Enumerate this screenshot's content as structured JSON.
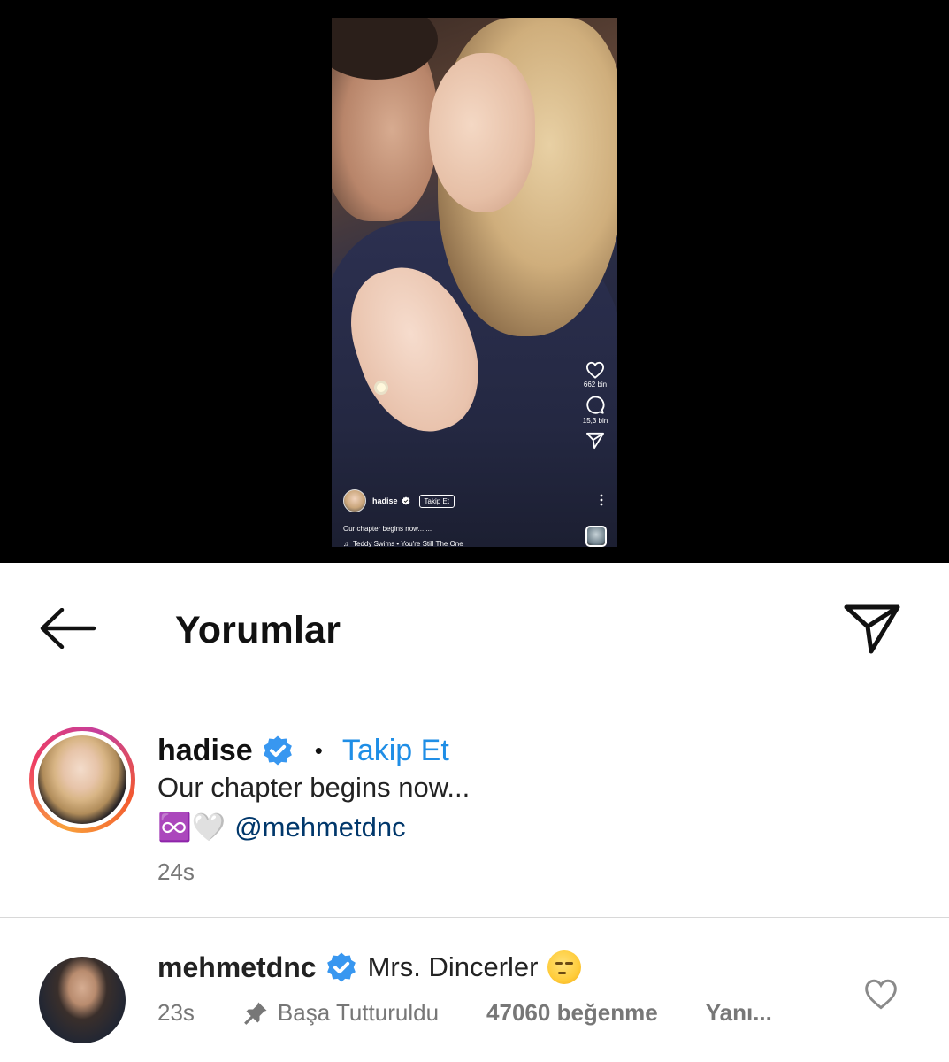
{
  "reel": {
    "likes_count": "662 bin",
    "comments_count": "15,3 bin",
    "username": "hadise",
    "follow_label": "Takip Et",
    "caption": "Our chapter begins now... ...",
    "music": "Teddy Swims • You're Still The One"
  },
  "header": {
    "title": "Yorumlar"
  },
  "post_caption": {
    "username": "hadise",
    "separator": "•",
    "follow_label": "Takip Et",
    "text": "Our chapter begins now...",
    "emojis": "♾️🤍",
    "mention": "@mehmetdnc",
    "time": "24s"
  },
  "comments": [
    {
      "username": "mehmetdnc",
      "text": "Mrs. Dincerler",
      "time": "23s",
      "pinned_label": "Başa Tutturuldu",
      "likes": "47060 beğenme",
      "reply_label": "Yanı..."
    }
  ],
  "colors": {
    "link_blue": "#1f8ee6",
    "mention_blue": "#00376b",
    "verified_blue": "#3897f0"
  }
}
